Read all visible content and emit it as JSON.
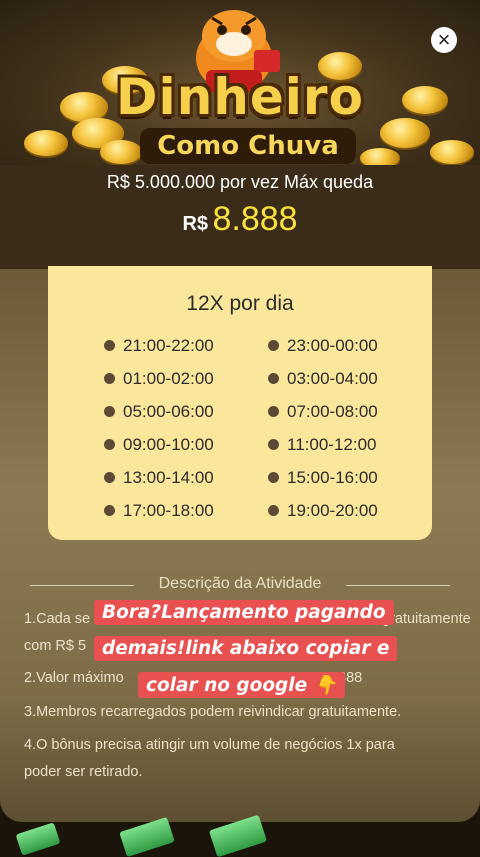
{
  "banner": {
    "title_line1": "Dinheiro",
    "title_line2": "Como Chuva"
  },
  "close": {
    "icon": "close-icon",
    "label": "×"
  },
  "prize": {
    "max_drop_text": "R$ 5.000.000 por vez Máx queda",
    "currency": "R$",
    "amount": "8.888"
  },
  "schedule": {
    "title": "12X por dia",
    "slots": [
      "21:00-22:00",
      "23:00-00:00",
      "01:00-02:00",
      "03:00-04:00",
      "05:00-06:00",
      "07:00-08:00",
      "09:00-10:00",
      "11:00-12:00",
      "13:00-14:00",
      "15:00-16:00",
      "17:00-18:00",
      "19:00-20:00"
    ]
  },
  "description": {
    "heading": "Descrição da Atividade",
    "line1a": "1.Cada se",
    "line1b": "gratuitamente",
    "line1c": "com R$ 5",
    "line2a": "2.Valor máximo",
    "line2b": "888",
    "line3": "3.Membros recarregados podem reivindicar gratuitamente.",
    "line4a": "4.O bônus precisa atingir um volume de negócios 1x para",
    "line4b": "poder ser retirado."
  },
  "overlay": {
    "line1": "Bora?Lançamento pagando",
    "line2": "demais!link abaixo copiar e",
    "line3": "colar no google 👇"
  },
  "colors": {
    "accent_yellow": "#fbe13c",
    "schedule_bg": "#fbe79c",
    "overlay_red": "#e8514f"
  }
}
